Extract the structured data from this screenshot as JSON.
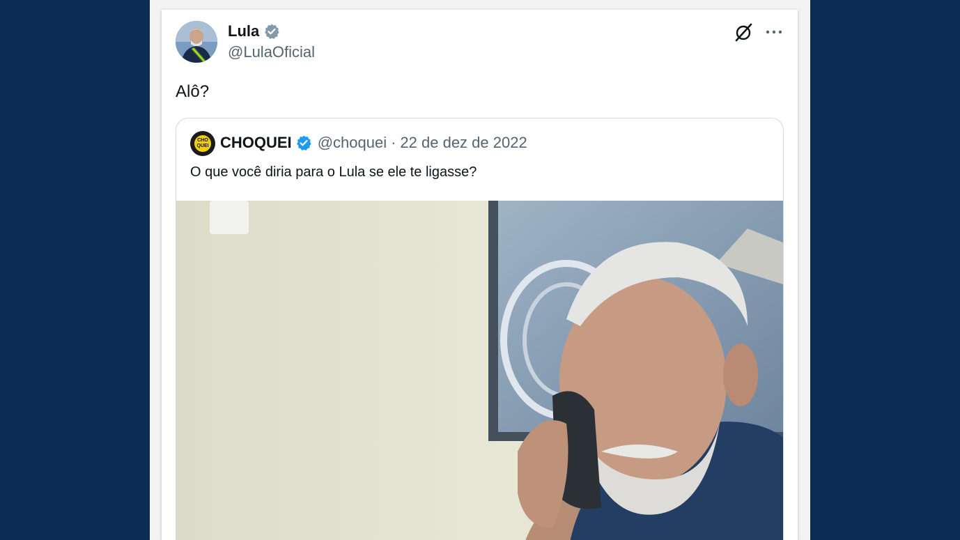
{
  "tweet": {
    "author_name": "Lula",
    "author_handle": "@LulaOficial",
    "text": "Alô?"
  },
  "quoted": {
    "author_name": "CHOQUEI",
    "author_handle": "@choquei",
    "separator": "·",
    "date": "22 de dez de 2022",
    "text": "O que você diria para o Lula se ele te ligasse?",
    "avatar_text": "CHO QUEI"
  },
  "icons": {
    "verified_gray": "verified-gray-icon",
    "verified_blue": "verified-blue-icon",
    "grok": "grok-icon",
    "more": "more-options-icon"
  },
  "colors": {
    "page_background": "#0b2d55",
    "verified_blue": "#1d9bf0",
    "verified_gray": "#829aab",
    "secondary_text": "#536471"
  }
}
